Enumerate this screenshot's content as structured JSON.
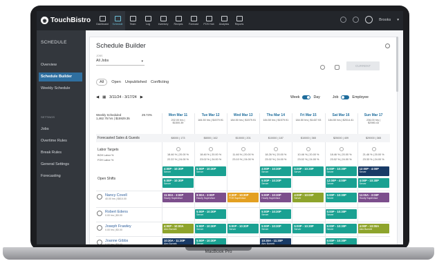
{
  "app": {
    "name": "TouchBistro",
    "user": "Brooks"
  },
  "nav": [
    {
      "label": "Dashboard"
    },
    {
      "label": "Schedule",
      "active": true
    },
    {
      "label": "Team"
    },
    {
      "label": "Log"
    },
    {
      "label": "Inventory"
    },
    {
      "label": "Recipes"
    },
    {
      "label": "Forecast"
    },
    {
      "label": "POS Hub"
    },
    {
      "label": "Analytics"
    },
    {
      "label": "Reports"
    }
  ],
  "sidebar": {
    "title": "SCHEDULE",
    "items": [
      {
        "label": "Overview"
      },
      {
        "label": "Schedule Builder",
        "active": true
      },
      {
        "label": "Weekly Schedule"
      }
    ],
    "settings_label": "SETTINGS",
    "settings": [
      {
        "label": "Jobs"
      },
      {
        "label": "Overtime Rules"
      },
      {
        "label": "Break Rules"
      },
      {
        "label": "General Settings"
      },
      {
        "label": "Forecasting"
      }
    ]
  },
  "page": {
    "title": "Schedule Builder",
    "jobs_label": "JOBS",
    "jobs_value": "All Jobs",
    "current_button": "CURRENT",
    "filters": [
      "All",
      "Open",
      "Unpublished",
      "Conflicting"
    ],
    "date_range": "3/11/24 - 3/17/24",
    "view_week": "Week",
    "view_day": "Day",
    "view_job": "Job",
    "view_employee": "Employee"
  },
  "grid": {
    "weekly": {
      "label": "Weekly Scheduled",
      "pct": "29.74%",
      "line2": "1,462.75 hrs | $15929.35"
    },
    "days": [
      {
        "name": "Mon Mar 11",
        "hrs": "202.00 hrs |",
        "amt": "$1500.39"
      },
      {
        "name": "Tue Mar 12",
        "hrs": "184.50 hrs | $1579.91",
        "amt": ""
      },
      {
        "name": "Wed Mar 13",
        "hrs": "184.50 hrs | $1579.91",
        "amt": ""
      },
      {
        "name": "Thu Mar 14",
        "hrs": "184.50 hrs | $1579.91",
        "amt": ""
      },
      {
        "name": "Fri Mar 15",
        "hrs": "184.50 hrs | $1437.93",
        "amt": ""
      },
      {
        "name": "Sat Mar 16",
        "hrs": "184.50 hrs | $2014.41",
        "amt": ""
      },
      {
        "name": "Sun Mar 17",
        "hrs": "236.00 hrs |",
        "amt": "$2980.43"
      }
    ],
    "forecast": {
      "label": "Forecasted Sales & Guests",
      "values": [
        "$8000 | 173",
        "$8000 | 162",
        "$10000 | 201",
        "$10000 | 187",
        "$10000 | 365",
        "$25000 | 409",
        "$29000 | 365"
      ]
    },
    "labor": {
      "label": "Labor Targets",
      "boh": "BOH Labor %",
      "foh": "FOH Labor %",
      "boh_values": [
        "18.46 % | 20.00 %",
        "18.46 % | 20.00 %",
        "11.46 % | 20.00 %",
        "18.26 % | 20.00 %",
        "10.46 % | 20.00 %",
        "18.46 % | 20.00 %",
        "21.46 % | 20.00 %"
      ],
      "foh_values": [
        "22.22 % | 24.00 %",
        "23.02 % | 24.00 %",
        "23.10 % | 24.00 %",
        "23.02 % | 24.00 %",
        "23.02 % | 24.00 %",
        "23.02 % | 24.00 %",
        "23.33 % | 24.00 %"
      ]
    },
    "open_shifts_label": "Open Shifts",
    "open_shifts": [
      {
        "day": 0,
        "color": "teal",
        "time": "4:00P - 10:30P",
        "role": "Server",
        "row": 0
      },
      {
        "day": 1,
        "color": "teal",
        "time": "5:00P - 10:30P",
        "role": "Server",
        "row": 0
      },
      {
        "day": 3,
        "color": "teal",
        "time": "4:00P - 10:30P",
        "role": "Server",
        "row": 0
      },
      {
        "day": 4,
        "color": "teal",
        "time": "5:00P - 10:30P",
        "role": "Server",
        "row": 0
      },
      {
        "day": 5,
        "color": "teal",
        "time": "5:00P - 10:30P",
        "role": "Server",
        "row": 0
      },
      {
        "day": 6,
        "color": "navy",
        "time": "12:00P - 4:00P",
        "role": "Server",
        "row": 0
      },
      {
        "day": 0,
        "color": "teal",
        "time": "5:00P - 10:30P",
        "role": "Server",
        "row": 1
      },
      {
        "day": 3,
        "color": "teal",
        "time": "5:00P - 10:30P",
        "role": "Server",
        "row": 1
      },
      {
        "day": 5,
        "color": "teal",
        "time": "12:00P - 4:00P",
        "role": "Server",
        "row": 1
      },
      {
        "day": 6,
        "color": "teal",
        "time": "4:00P - 10:30P",
        "role": "Server",
        "row": 1
      }
    ],
    "employees": [
      {
        "name": "Nancy Covell",
        "sub": "40.00 hrs | $810.00",
        "shifts": [
          {
            "day": 0,
            "color": "purple",
            "time": "11:00A - 3:00P",
            "role": "Hourly Supervisor"
          },
          {
            "day": 1,
            "color": "purple",
            "time": "8:00A - 3:00P",
            "role": "Hourly Supervisor"
          },
          {
            "day": 2,
            "color": "orange",
            "time": "2:30P - 10:30P",
            "role": "FOH Supervisor"
          },
          {
            "day": 3,
            "color": "purple",
            "time": "5:00P - 10:30P",
            "role": "Hourly Supervisor"
          },
          {
            "day": 4,
            "color": "olive",
            "time": "4:00P - 10:00P",
            "role": "Server"
          },
          {
            "day": 5,
            "color": "teal",
            "time": "5:00P - 10:30P",
            "role": "Server"
          },
          {
            "day": 6,
            "color": "purple",
            "time": "11:00A - 3:00P",
            "role": "Hourly Supervisor"
          }
        ]
      },
      {
        "name": "Robert Edens",
        "sub": "0.00 hrs | $0.00",
        "shifts": [
          {
            "day": 1,
            "color": "teal",
            "time": "5:00P - 10:30P",
            "role": "Server"
          },
          {
            "day": 3,
            "color": "teal",
            "time": "5:00P - 10:30P",
            "role": "Server"
          },
          {
            "day": 5,
            "color": "teal",
            "time": "5:00P - 10:30P",
            "role": "Server"
          }
        ]
      },
      {
        "name": "Joseph Frawley",
        "sub": "0.00 hrs | $0.00",
        "shifts": [
          {
            "day": 0,
            "color": "olive",
            "time": "4:00P - 10:00A",
            "role": "Alex Burnett"
          },
          {
            "day": 1,
            "color": "teal",
            "time": "5:00P - 10:30P",
            "role": "Server"
          },
          {
            "day": 2,
            "color": "teal",
            "time": "5:00P - 10:30P",
            "role": "Server"
          },
          {
            "day": 3,
            "color": "teal",
            "time": "5:00P - 10:30P",
            "role": "Server"
          },
          {
            "day": 4,
            "color": "teal",
            "time": "5:00P - 10:30P",
            "role": "Server"
          },
          {
            "day": 5,
            "color": "teal",
            "time": "5:00P - 10:30P",
            "role": "Server"
          },
          {
            "day": 6,
            "color": "olive",
            "time": "4:00P - 10:00A",
            "role": "Alex Burnett"
          }
        ]
      },
      {
        "name": "Joanne Gibbs",
        "sub": "0.00 hrs | $0.00",
        "shifts": [
          {
            "day": 0,
            "color": "navy",
            "time": "10:30A - 11:30P",
            "role": "Alex Burnett"
          },
          {
            "day": 1,
            "color": "teal",
            "time": "5:00P - 10:30P",
            "role": "Server"
          },
          {
            "day": 3,
            "color": "navy",
            "time": "10:30A - 11:30P",
            "role": "Alex Burnett"
          },
          {
            "day": 5,
            "color": "teal",
            "time": "5:00P - 10:30P",
            "role": "Server"
          }
        ]
      }
    ]
  },
  "device_label": "MacBook Pro"
}
